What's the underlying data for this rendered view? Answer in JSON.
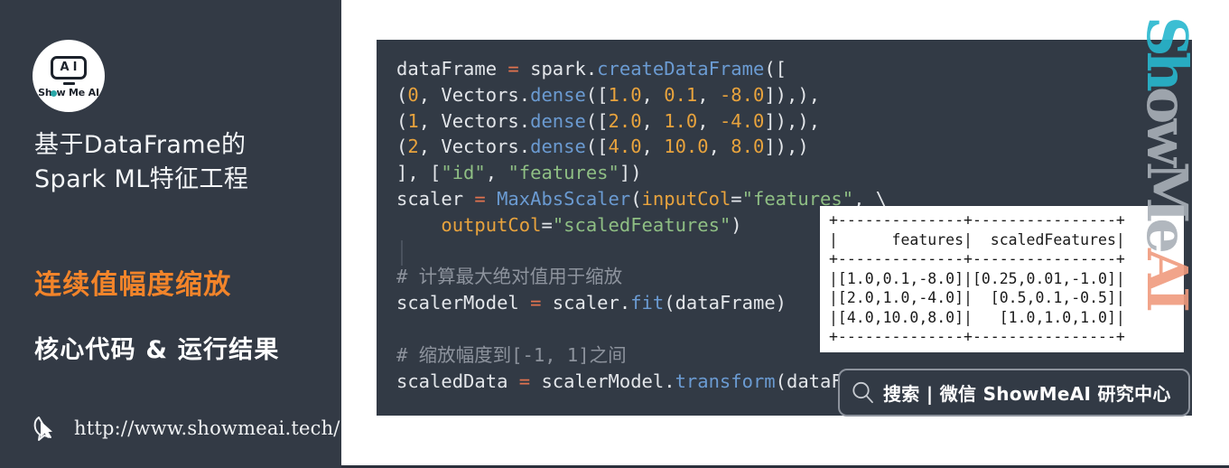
{
  "sidebar": {
    "logo": {
      "icon_letters": [
        "A",
        "I"
      ],
      "brand_pre": "Sh",
      "brand_post": "w Me AI",
      "alt": "Show Me AI"
    },
    "headline_line1": "基于DataFrame的",
    "headline_line2": "Spark ML特征工程",
    "kicker": "连续值幅度缩放",
    "subkicker": "核心代码 & 运行结果",
    "url": "http://www.showmeai.tech/",
    "colors": {
      "background": "#333a45",
      "kicker": "#f2842a",
      "text": "#ffffff"
    }
  },
  "code_panel": {
    "language": "python",
    "background": "#323a45",
    "lines": [
      "dataFrame = spark.createDataFrame([",
      "(0, Vectors.dense([1.0, 0.1, -8.0]),),",
      "(1, Vectors.dense([2.0, 1.0, -4.0]),),",
      "(2, Vectors.dense([4.0, 10.0, 8.0]),)",
      "], [\"id\", \"features\"])",
      "scaler = MaxAbsScaler(inputCol=\"features\", \\",
      "    outputCol=\"scaledFeatures\")",
      "",
      "# 计算最大绝对值用于缩放",
      "scalerModel = scaler.fit(dataFrame)",
      "",
      "# 缩放幅度到[-1, 1]之间",
      "scaledData = scalerModel.transform(dataFrame)"
    ],
    "comments": [
      "# 计算最大绝对值用于缩放",
      "# 缩放幅度到[-1, 1]之间"
    ],
    "syntax_colors": {
      "plain": "#e3e6ea",
      "function": "#6b9bd2",
      "number": "#e8a33d",
      "string": "#8fbf84",
      "operator": "#e0734f",
      "comment": "#8d939d"
    }
  },
  "result_table": {
    "headers": [
      "features",
      "scaledFeatures"
    ],
    "rows": [
      [
        "[1.0,0.1,-8.0]",
        "[0.25,0.01,-1.0]"
      ],
      [
        "[2.0,1.0,-4.0]",
        "[0.5,0.1,-0.5]"
      ],
      [
        "[4.0,10.0,8.0]",
        "[1.0,1.0,1.0]"
      ]
    ],
    "ascii": "+--------------+----------------+\n|      features|  scaledFeatures|\n+--------------+----------------+\n|[1.0,0.1,-8.0]|[0.25,0.01,-1.0]|\n|[2.0,1.0,-4.0]|  [0.5,0.1,-0.5]|\n|[4.0,10.0,8.0]|   [1.0,1.0,1.0]|\n+--------------+----------------+"
  },
  "watermark": {
    "part1": "Sh",
    "part2": "owMe",
    "part3": "AI",
    "full": "ShowMeAI",
    "colors": [
      "#28b8cf",
      "#a9b0b8",
      "#f09b7e"
    ]
  },
  "search_bar": {
    "text": "搜索 | 微信 ShowMeAI 研究中心",
    "icon": "search-icon"
  }
}
